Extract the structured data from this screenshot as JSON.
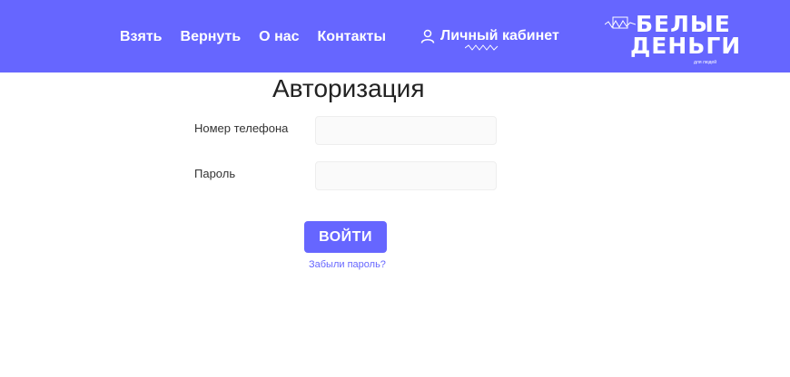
{
  "nav": {
    "items": [
      {
        "label": "Взять"
      },
      {
        "label": "Вернуть"
      },
      {
        "label": "О нас"
      },
      {
        "label": "Контакты"
      }
    ],
    "cabinet_label": "Личный кабинет"
  },
  "logo": {
    "line1": "БЕЛЫЕ",
    "line2": "ДЕНЬГИ",
    "tagline": "для людей"
  },
  "form": {
    "title": "Авторизация",
    "phone_label": "Номер телефона",
    "phone_value": "",
    "password_label": "Пароль",
    "password_value": "",
    "submit_label": "ВОЙТИ",
    "forgot_label": "Забыли пароль?"
  },
  "colors": {
    "brand": "#6666ff",
    "text": "#222222",
    "field_bg": "#fafafa"
  },
  "icons": {
    "cabinet": "user-icon",
    "logo_decoration": "wave-icon"
  }
}
